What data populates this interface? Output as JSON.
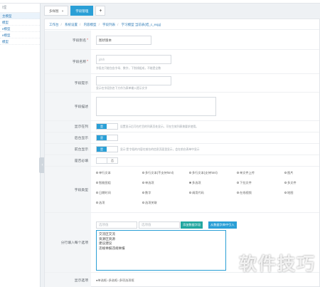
{
  "topnav": {
    "items": [
      "",
      "",
      "",
      "",
      "",
      "",
      ""
    ]
  },
  "sidebar": {
    "group": "l理",
    "items": [
      {
        "label": "主模型",
        "active": true
      },
      {
        "label": "模型"
      },
      {
        "label": "e模型"
      },
      {
        "label": "e模型"
      },
      {
        "label": "模型"
      }
    ]
  },
  "tabs": {
    "items": [
      {
        "label": "多样图",
        "close": "×"
      },
      {
        "label": "字段管理",
        "active": true
      }
    ],
    "add_label": "+"
  },
  "breadcrumb": [
    "工作台",
    "系统设置",
    "内容模型",
    "字段列表",
    "学习模型 当前表(结_c_exjg)"
  ],
  "form": {
    "field_alias": {
      "label": "字段别名",
      "required": "*",
      "value": "图状版本"
    },
    "field_name": {
      "label": "字段名称",
      "required": "*",
      "value": "jdsh",
      "hint": "字段名只能包含字母、数字，下划线组成，不能是全数"
    },
    "field_tip": {
      "label": "字段提示",
      "hint": "显示在字段别名下方作为表单输入提示文字"
    },
    "field_desc": {
      "label": "字段描述"
    },
    "show_on_list": {
      "label": "显示在列",
      "on_label": "是",
      "hint": "设置显示后可在栏目的列表页处显示，可在生效列表按要求使用。"
    },
    "backend_show": {
      "label": "后台显示",
      "on_label": "是"
    },
    "frontend_show": {
      "label": "前台显示",
      "on_label": "是",
      "hint": "显示'是'字段的内容在前台的信息页面里显示，会在前台表单中显示"
    },
    "required": {
      "label": "是否必填",
      "on_label": "否"
    },
    "field_type": {
      "label": "字段类型",
      "options": [
        {
          "label": "单行文本"
        },
        {
          "label": "多行文本(不支持html)"
        },
        {
          "label": "多行文本(支持html)"
        },
        {
          "label": "单文件上传"
        },
        {
          "label": "图片"
        },
        {
          "label": "智能图组"
        },
        {
          "label": "单选项"
        },
        {
          "label": "多选项",
          "checked": true
        },
        {
          "label": "下拉文件"
        },
        {
          "label": "多文件"
        },
        {
          "label": "日期时间"
        },
        {
          "label": "数字"
        },
        {
          "label": "调用代码"
        },
        {
          "label": "在线视频"
        },
        {
          "label": "地图"
        },
        {
          "label": "选项"
        },
        {
          "label": "选项关联"
        }
      ]
    },
    "options": {
      "label": "分行填入每个选项",
      "placeholder1": "选项值",
      "placeholder2": "选项值",
      "btn_add": "添加数据字段",
      "btn_import": "从数据字典中引入",
      "lines": [
        "交流区交流",
        "资源区资源",
        "建议建议",
        "违规举报违规举报"
      ]
    },
    "display": {
      "label": "显示选项",
      "value": "●单选框○多选框○多项选项框"
    }
  },
  "watermark": "软件技巧"
}
